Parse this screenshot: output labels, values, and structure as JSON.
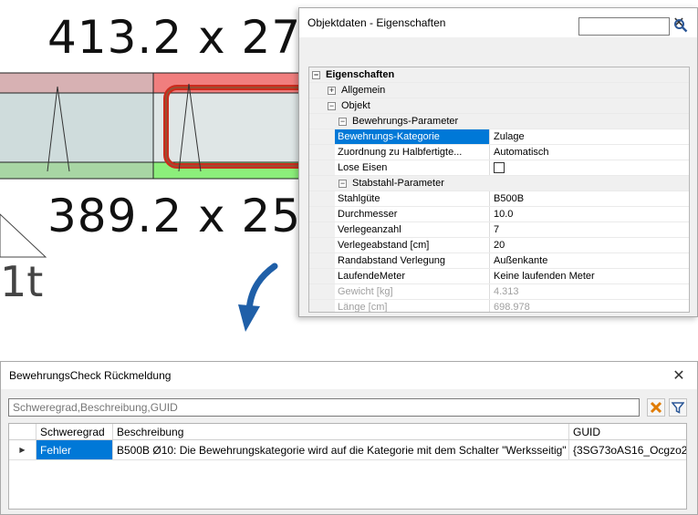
{
  "cad": {
    "dimension_top": "413.2 x 27",
    "dimension_bottom": "389.2 x 25",
    "fragment_label": "1t"
  },
  "properties_window": {
    "title": "Objektdaten - Eigenschaften",
    "search_value": "",
    "sections": {
      "root": "Eigenschaften",
      "allgemein": "Allgemein",
      "objekt": "Objekt",
      "bewehrung": "Bewehrungs-Parameter",
      "stabstahl": "Stabstahl-Parameter"
    },
    "bewehrung_rows": [
      {
        "name": "Bewehrungs-Kategorie",
        "value": "Zulage"
      },
      {
        "name": "Zuordnung zu Halbfertigte...",
        "value": "Automatisch"
      },
      {
        "name": "Lose Eisen",
        "value": ""
      }
    ],
    "stabstahl_rows": [
      {
        "name": "Stahlgüte",
        "value": "B500B"
      },
      {
        "name": "Durchmesser",
        "value": "10.0"
      },
      {
        "name": "Verlegeanzahl",
        "value": "7"
      },
      {
        "name": "Verlegeabstand [cm]",
        "value": "20"
      },
      {
        "name": "Randabstand Verlegung",
        "value": "Außenkante"
      },
      {
        "name": "LaufendeMeter",
        "value": "Keine laufenden Meter"
      },
      {
        "name": "Gewicht [kg]",
        "value": "4.313"
      },
      {
        "name": "Länge [cm]",
        "value": "698.978"
      }
    ]
  },
  "feedback_window": {
    "title": "BewehrungsCheck Rückmeldung",
    "filter_text": "Schweregrad,Beschreibung,GUID",
    "columns": [
      "",
      "Schweregrad",
      "Beschreibung",
      "GUID"
    ],
    "rows": [
      {
        "marker": "▶",
        "schweregrad": "Fehler",
        "beschreibung": "B500B Ø10: Die Bewehrungskategorie wird auf die Kategorie mit dem Schalter \"Werksseitig\" geändert.",
        "guid": "{3SG73oAS16_Ocgzo2..."
      }
    ]
  },
  "colors": {
    "selection": "#0078d7",
    "clear_icon": "#e07b00",
    "filter_icon": "#2b5797",
    "arrow": "#1f5fa8",
    "rebar_red": "#cc2b1d"
  }
}
